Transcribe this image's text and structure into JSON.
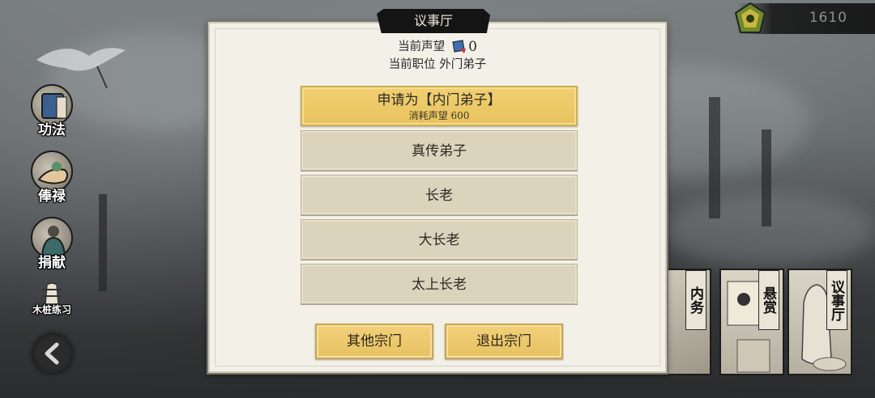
{
  "currency": {
    "amount": "1610",
    "icon": "currency-gem-icon"
  },
  "side_menu": [
    {
      "key": "gongfa",
      "label": "功法",
      "icon": "scroll-book-icon"
    },
    {
      "key": "fenglu",
      "label": "俸禄",
      "icon": "open-hand-icon"
    },
    {
      "key": "juanxian",
      "label": "捐献",
      "icon": "robed-figure-icon"
    },
    {
      "key": "muzhuang",
      "label": "木桩练习",
      "icon": "training-dummy-icon"
    }
  ],
  "right_cards": [
    {
      "key": "neiwu",
      "label": "内务"
    },
    {
      "key": "xuanshang",
      "label": "悬赏"
    },
    {
      "key": "yishiting",
      "label": "议事厅"
    }
  ],
  "dialog": {
    "title": "议事厅",
    "reputation_label": "当前声望",
    "reputation_value": "0",
    "position_label": "当前职位",
    "position_value": "外门弟子",
    "ranks": [
      {
        "label": "申请为【内门弟子】",
        "sub": "消耗声望 600",
        "active": true
      },
      {
        "label": "真传弟子",
        "active": false
      },
      {
        "label": "长老",
        "active": false
      },
      {
        "label": "大长老",
        "active": false
      },
      {
        "label": "太上长老",
        "active": false
      }
    ],
    "other_sects_label": "其他宗门",
    "leave_sect_label": "退出宗门"
  },
  "colors": {
    "accent": "#e9c462",
    "dialog_bg": "#f3f0e8",
    "rank_button": "#dcd3bc",
    "title_bar": "#141414"
  }
}
